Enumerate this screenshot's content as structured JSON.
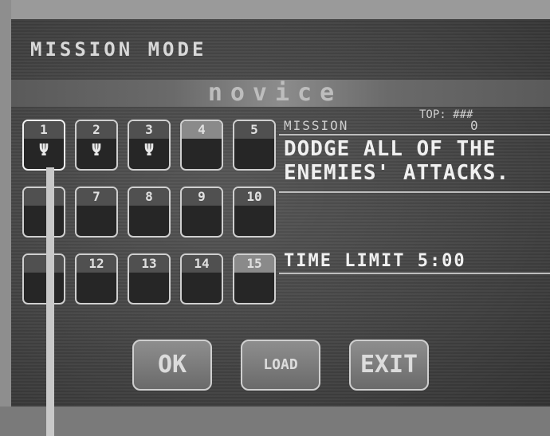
{
  "title": "MISSION MODE",
  "difficulty": "novice",
  "top_score": "TOP: ###",
  "missions": [
    {
      "num": "1",
      "trophy": "Ψ"
    },
    {
      "num": "2",
      "trophy": "Ψ"
    },
    {
      "num": "3",
      "trophy": "Ψ"
    },
    {
      "num": "4",
      "trophy": ""
    },
    {
      "num": "5",
      "trophy": ""
    },
    {
      "num": "",
      "trophy": ""
    },
    {
      "num": "7",
      "trophy": ""
    },
    {
      "num": "8",
      "trophy": ""
    },
    {
      "num": "9",
      "trophy": ""
    },
    {
      "num": "10",
      "trophy": ""
    },
    {
      "num": "",
      "trophy": ""
    },
    {
      "num": "12",
      "trophy": ""
    },
    {
      "num": "13",
      "trophy": ""
    },
    {
      "num": "14",
      "trophy": ""
    },
    {
      "num": "15",
      "trophy": ""
    }
  ],
  "mission_info": {
    "label": "MISSION",
    "number": "0",
    "description": "DODGE ALL OF THE ENEMIES' ATTACKS.",
    "time_limit": "TIME LIMIT  5:00"
  },
  "buttons": {
    "ok": "OK",
    "load": "LOAD",
    "exit": "EXIT"
  }
}
